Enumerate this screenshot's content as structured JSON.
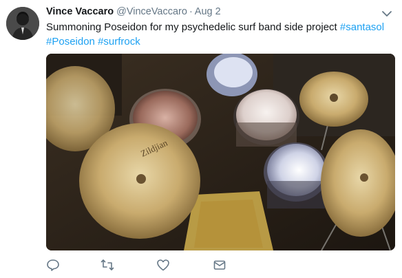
{
  "tweet": {
    "display_name": "Vince Vaccaro",
    "handle": "@VinceVaccaro",
    "separator": "·",
    "timestamp": "Aug 2",
    "text_main": "Summoning Poseidon for my psychedelic surf band side project ",
    "hashtags": [
      "#santasol",
      "#Poseidon",
      "#surfrock"
    ],
    "media_brand_mark": "Zildjian"
  },
  "icons": {
    "caret": "chevron-down-icon",
    "reply": "reply-icon",
    "retweet": "retweet-icon",
    "like": "heart-icon",
    "dm": "envelope-icon"
  },
  "colors": {
    "text": "#14171a",
    "secondary": "#657786",
    "link": "#1da1f2",
    "icon": "#657786"
  }
}
